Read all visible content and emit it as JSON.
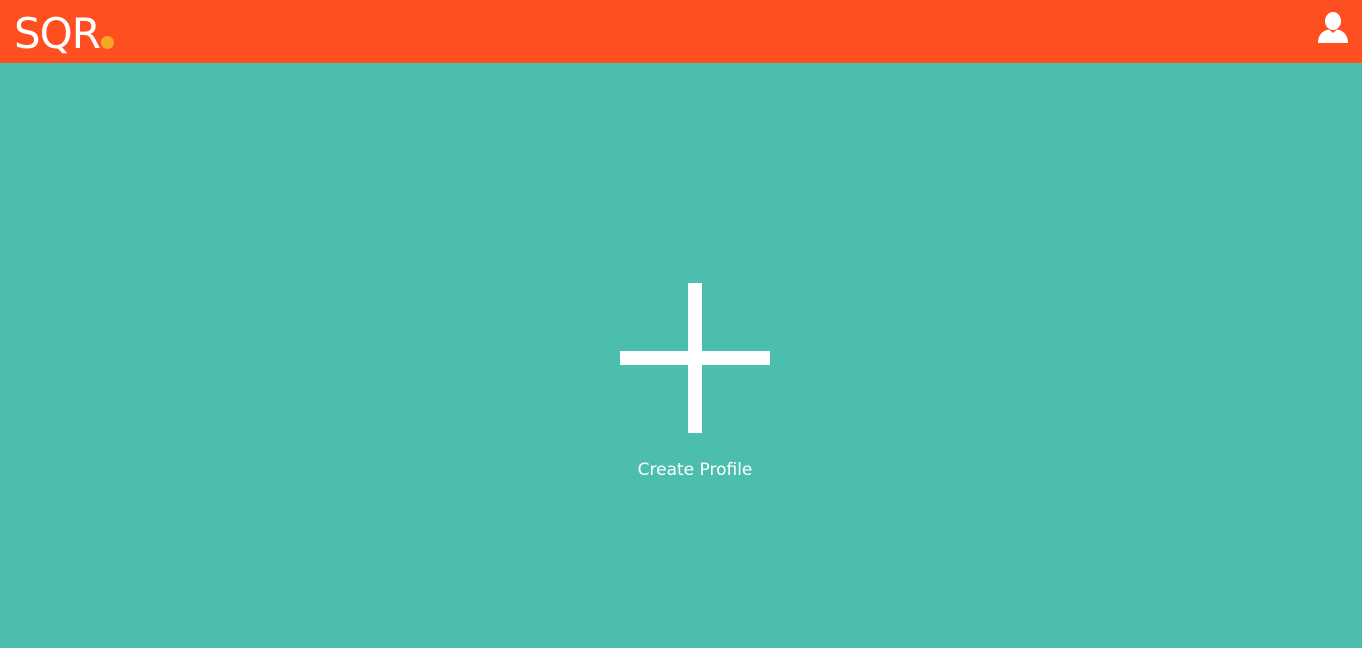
{
  "header": {
    "logo_text": "SQR",
    "logo_dot_color": "#F9A825",
    "user_icon": "user-icon",
    "background_color": "#FF4E1F"
  },
  "main": {
    "background_color": "#4CBEAD",
    "create_profile": {
      "icon": "plus-icon",
      "label": "Create Profile"
    }
  }
}
